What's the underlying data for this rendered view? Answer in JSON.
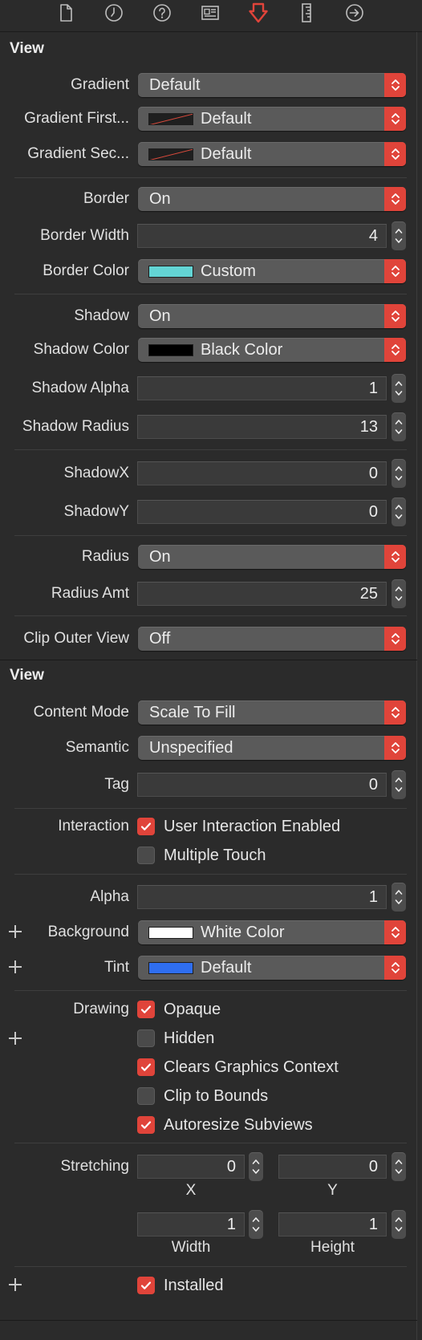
{
  "toolbar": {
    "icons": [
      "file-inspector-icon",
      "history-inspector-icon",
      "quick-help-icon",
      "identity-inspector-icon",
      "attributes-inspector-icon",
      "size-inspector-icon",
      "connections-inspector-icon"
    ],
    "active": "attributes-inspector-icon",
    "accent_color": "#e0443a"
  },
  "custom_view": {
    "title": "View",
    "gradient": {
      "label": "Gradient",
      "value": "Default"
    },
    "gradient_first": {
      "label": "Gradient First...",
      "value": "Default"
    },
    "gradient_second": {
      "label": "Gradient Sec...",
      "value": "Default"
    },
    "border": {
      "label": "Border",
      "value": "On"
    },
    "border_width": {
      "label": "Border Width",
      "value": "4"
    },
    "border_color": {
      "label": "Border Color",
      "value": "Custom",
      "swatch": "#63d4d4"
    },
    "shadow": {
      "label": "Shadow",
      "value": "On"
    },
    "shadow_color": {
      "label": "Shadow Color",
      "value": "Black Color",
      "swatch": "#000000"
    },
    "shadow_alpha": {
      "label": "Shadow Alpha",
      "value": "1"
    },
    "shadow_radius": {
      "label": "Shadow Radius",
      "value": "13"
    },
    "shadow_x": {
      "label": "ShadowX",
      "value": "0"
    },
    "shadow_y": {
      "label": "ShadowY",
      "value": "0"
    },
    "radius": {
      "label": "Radius",
      "value": "On"
    },
    "radius_amt": {
      "label": "Radius Amt",
      "value": "25"
    },
    "clip_outer_view": {
      "label": "Clip Outer View",
      "value": "Off"
    }
  },
  "view": {
    "title": "View",
    "content_mode": {
      "label": "Content Mode",
      "value": "Scale To Fill"
    },
    "semantic": {
      "label": "Semantic",
      "value": "Unspecified"
    },
    "tag": {
      "label": "Tag",
      "value": "0"
    },
    "interaction": {
      "label": "Interaction",
      "options": [
        {
          "label": "User Interaction Enabled",
          "checked": true
        },
        {
          "label": "Multiple Touch",
          "checked": false
        }
      ]
    },
    "alpha": {
      "label": "Alpha",
      "value": "1"
    },
    "background": {
      "label": "Background",
      "value": "White Color",
      "swatch": "#ffffff"
    },
    "tint": {
      "label": "Tint",
      "value": "Default",
      "swatch": "#2f6ef0"
    },
    "drawing": {
      "label": "Drawing",
      "options": [
        {
          "label": "Opaque",
          "checked": true
        },
        {
          "label": "Hidden",
          "checked": false
        },
        {
          "label": "Clears Graphics Context",
          "checked": true
        },
        {
          "label": "Clip to Bounds",
          "checked": false
        },
        {
          "label": "Autoresize Subviews",
          "checked": true
        }
      ]
    },
    "stretching": {
      "label": "Stretching",
      "x": {
        "label": "X",
        "value": "0"
      },
      "y": {
        "label": "Y",
        "value": "0"
      },
      "width": {
        "label": "Width",
        "value": "1"
      },
      "height": {
        "label": "Height",
        "value": "1"
      }
    },
    "installed": {
      "label": "Installed",
      "checked": true
    }
  }
}
